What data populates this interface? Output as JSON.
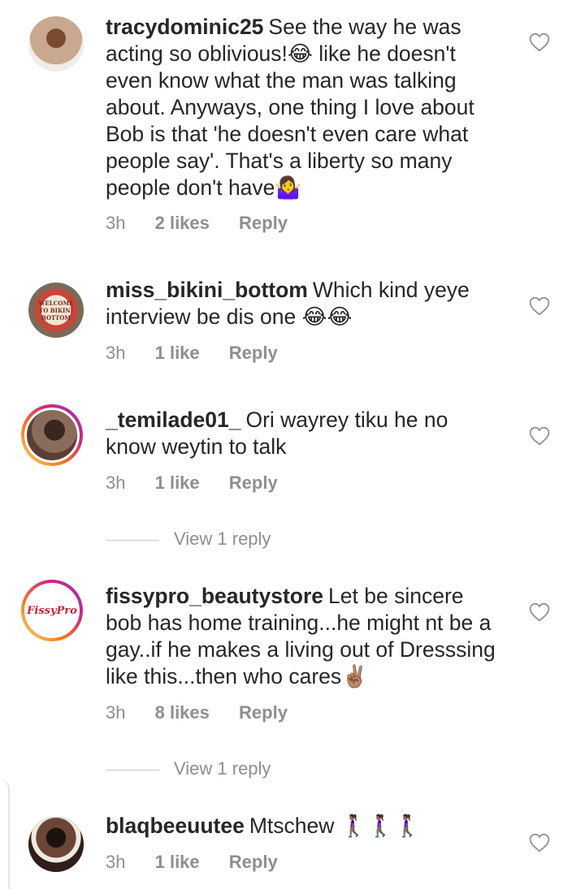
{
  "comments": [
    {
      "username": "tracydominic25",
      "text": "See the way he was acting so oblivious!😂 like he doesn't even know what the man was talking about. Anyways, one thing I love about Bob is that 'he doesn't even care what people say'. That's a liberty so many people don't have🤷‍♀️",
      "time": "3h",
      "likes": "2 likes",
      "reply": "Reply",
      "avatar_color": "#c8a98f"
    },
    {
      "username": "miss_bikini_bottom",
      "text": "Which kind yeye interview be dis one 😂😂",
      "time": "3h",
      "likes": "1 like",
      "reply": "Reply",
      "avatar_text": "WELCOME TO BIKINI BOTTOM",
      "avatar_color": "#b8a48c"
    },
    {
      "username": "_temilade01_",
      "text": "Ori wayrey tiku he no know weytin to talk",
      "time": "3h",
      "likes": "1 like",
      "reply": "Reply",
      "view_replies": "View 1 reply",
      "avatar_color": "#6e4d3e"
    },
    {
      "username": "fissypro_beautystore",
      "text": "Let be sincere bob has home training...he might nt be a gay..if he makes a living out of Dresssing like this...then who cares✌🏽",
      "time": "3h",
      "likes": "8 likes",
      "reply": "Reply",
      "view_replies": "View 1 reply",
      "avatar_text": "FissyPro",
      "avatar_color": "#ffffff"
    },
    {
      "username": "blaqbeeuutee",
      "text": "Mtschew 🚶🏾‍♀️🚶🏾‍♀️🚶🏾‍♀️",
      "time": "3h",
      "likes": "1 like",
      "reply": "Reply",
      "avatar_color": "#3b2a22"
    }
  ]
}
